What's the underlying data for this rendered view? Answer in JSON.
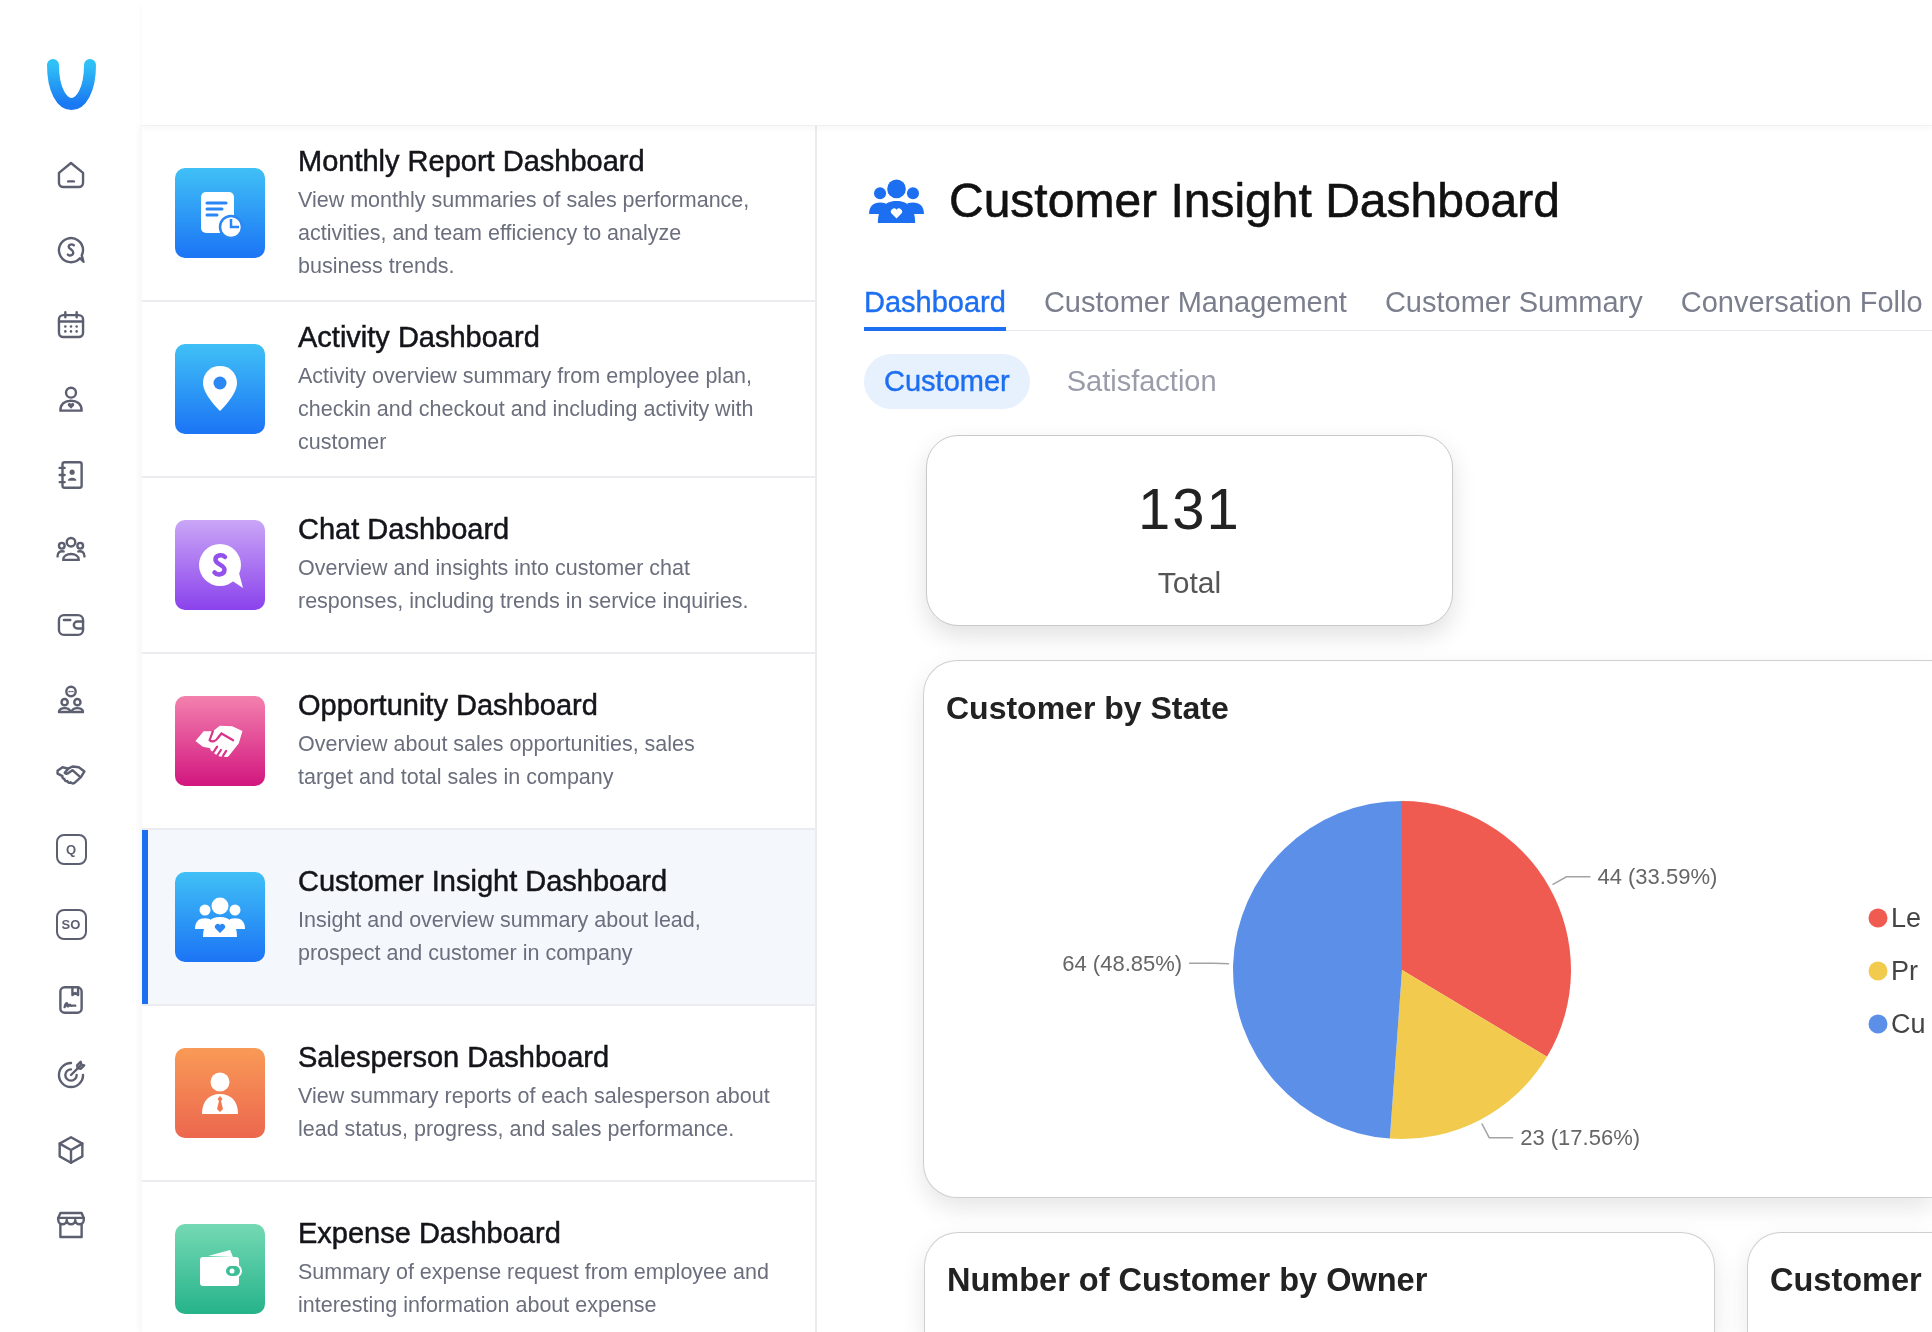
{
  "rail": {
    "letter_tiles": [
      "Q",
      "SO"
    ]
  },
  "dashboards": [
    {
      "title": "Monthly Report Dashboard",
      "description": "View monthly summaries of sales performance,\nactivities, and team efficiency to analyze\nbusiness trends.",
      "selected": false
    },
    {
      "title": "Activity Dashboard",
      "description": "Activity overview summary from employee plan,\ncheckin and checkout and including activity with\ncustomer",
      "selected": false
    },
    {
      "title": "Chat Dashboard",
      "description": "Overview and insights into customer chat\nresponses, including trends in service inquiries.",
      "selected": false
    },
    {
      "title": "Opportunity Dashboard",
      "description": "Overview about sales opportunities, sales\ntarget and total sales in company",
      "selected": false
    },
    {
      "title": "Customer Insight Dashboard",
      "description": "Insight and overview summary about lead,\nprospect and customer in company",
      "selected": true
    },
    {
      "title": "Salesperson Dashboard",
      "description": "View summary reports of each salesperson about\nlead status, progress, and sales performance.",
      "selected": false
    },
    {
      "title": "Expense Dashboard",
      "description": "Summary of expense request from employee and\ninteresting information about expense",
      "selected": false
    }
  ],
  "header": {
    "title": "Customer Insight Dashboard"
  },
  "tabs": [
    {
      "label": "Dashboard",
      "selected": true
    },
    {
      "label": "Customer Management",
      "selected": false
    },
    {
      "label": "Customer Summary",
      "selected": false
    },
    {
      "label": "Conversation Follo",
      "selected": false
    }
  ],
  "subtabs": [
    {
      "label": "Customer",
      "selected": true
    },
    {
      "label": "Satisfaction",
      "selected": false
    }
  ],
  "total_card": {
    "value": "131",
    "label": "Total"
  },
  "state_chart": {
    "chart_data": {
      "type": "pie",
      "title": "Customer by State",
      "categories": [
        "Le",
        "Pr",
        "Cu"
      ],
      "values": [
        44,
        23,
        64
      ],
      "value_labels": [
        "44 (33.59%)",
        "23 (17.56%)",
        "64 (48.85%)"
      ],
      "legend": "right"
    },
    "slices": [
      {
        "color": "#ef5b51"
      },
      {
        "color": "#f2cb4e"
      },
      {
        "color": "#5b8fe8"
      }
    ]
  },
  "bottom_cards": [
    {
      "title": "Number of Customer by Owner"
    },
    {
      "title": "Customer"
    }
  ]
}
